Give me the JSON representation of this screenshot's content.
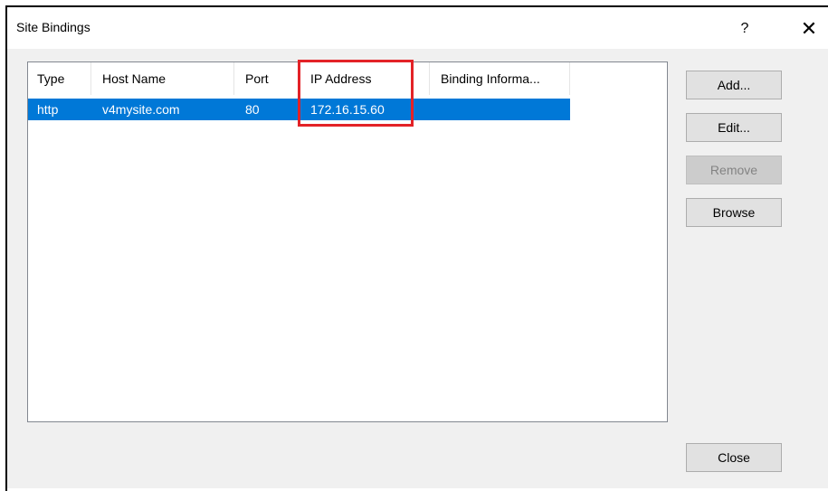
{
  "window": {
    "title": "Site Bindings",
    "help": "?",
    "close_glyph": "✕"
  },
  "list": {
    "columns": [
      "Type",
      "Host Name",
      "Port",
      "IP Address",
      "Binding Informa..."
    ],
    "rows": [
      {
        "type": "http",
        "host": "v4mysite.com",
        "port": "80",
        "ip": "172.16.15.60",
        "info": ""
      }
    ]
  },
  "buttons": {
    "add": "Add...",
    "edit": "Edit...",
    "remove": "Remove",
    "browse": "Browse",
    "close": "Close"
  },
  "colors": {
    "selection": "#0078d7",
    "annotation": "#e32227"
  }
}
